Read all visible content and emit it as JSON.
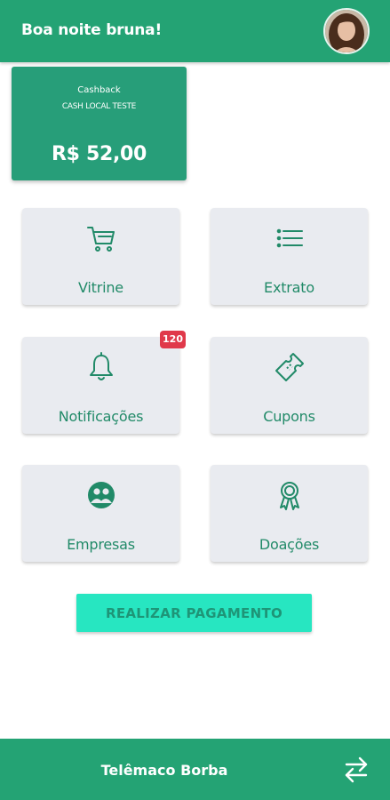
{
  "header": {
    "greeting": "Boa noite bruna!"
  },
  "cashback": {
    "title": "Cashback",
    "subtitle": "CASH LOCAL TESTE",
    "amount": "R$ 52,00"
  },
  "menu": {
    "vitrine": "Vitrine",
    "extrato": "Extrato",
    "notificacoes": "Notificações",
    "notificacoes_badge": "120",
    "cupons": "Cupons",
    "empresas": "Empresas",
    "doacoes": "Doações"
  },
  "actions": {
    "pay_label": "REALIZAR PAGAMENTO"
  },
  "footer": {
    "city": "Telêmaco Borba"
  },
  "colors": {
    "brand": "#24a374",
    "accent": "#27e6c1",
    "tile": "#e9ebf0",
    "badge": "#e0394a",
    "icon": "#218a68"
  },
  "icons": [
    "cart-icon",
    "list-icon",
    "bell-icon",
    "ticket-icon",
    "people-icon",
    "award-icon",
    "swap-icon"
  ]
}
